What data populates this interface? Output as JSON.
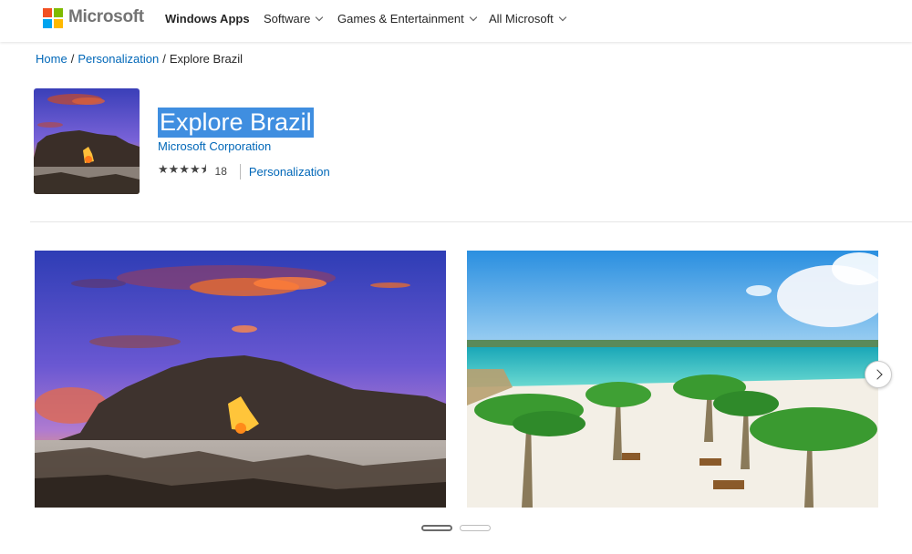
{
  "header": {
    "brand": "Microsoft",
    "logo_colors": [
      "#f25022",
      "#7fba00",
      "#00a4ef",
      "#ffb900"
    ],
    "nav": [
      {
        "label": "Windows Apps"
      },
      {
        "label": "Software"
      },
      {
        "label": "Games & Entertainment"
      },
      {
        "label": "All Microsoft"
      }
    ]
  },
  "breadcrumb": {
    "home": "Home",
    "sep1": "/",
    "category": "Personalization",
    "sep2": "/",
    "current": "Explore Brazil"
  },
  "app": {
    "title": "Explore Brazil",
    "publisher": "Microsoft Corporation",
    "stars_glyphs": "★★★★⯨",
    "rating": 4.5,
    "rating_count": "18",
    "category": "Personalization"
  },
  "carousel": {
    "screenshots": [
      "rock-arch-sunset",
      "tropical-beach-palms"
    ],
    "pages": 2,
    "active_page": 1
  },
  "colors": {
    "link": "#0067b8",
    "title_highlight": "#3f8ee0"
  }
}
